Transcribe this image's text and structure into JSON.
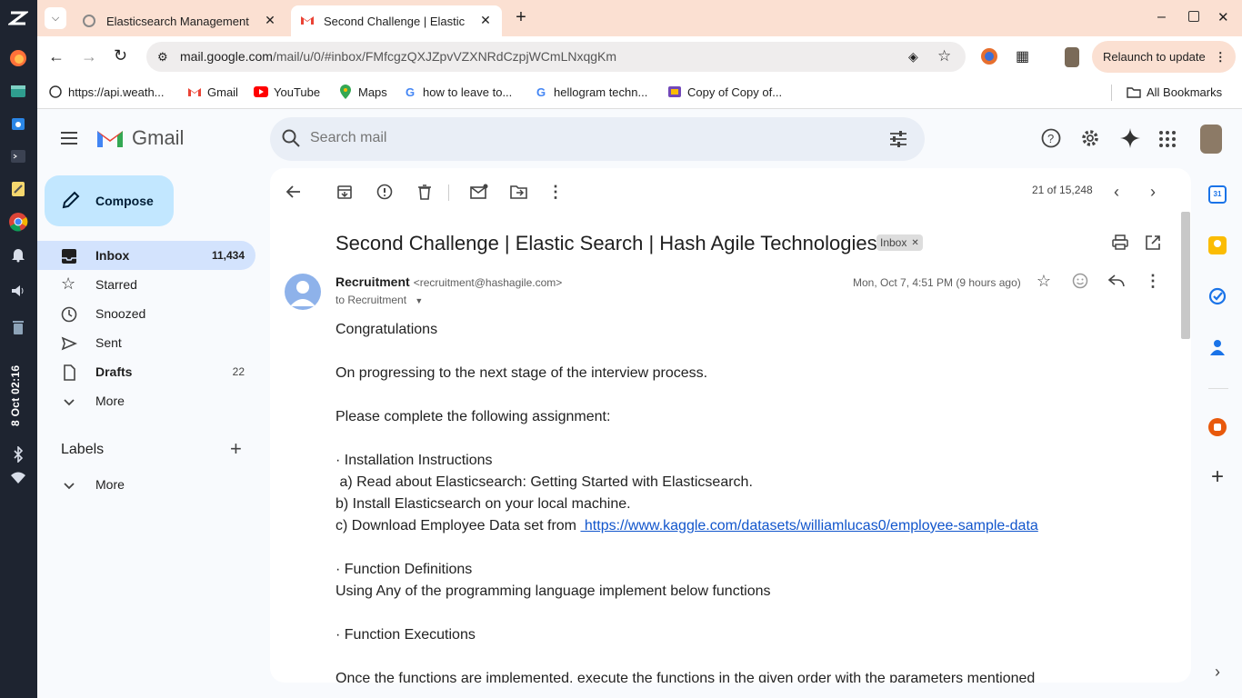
{
  "taskbar": {
    "clock": "8 Oct 02:16"
  },
  "browser": {
    "tabs": [
      {
        "title": "Elasticsearch Management"
      },
      {
        "title": "Second Challenge | Elastic"
      }
    ],
    "url_host": "mail.google.com",
    "url_path": "/mail/u/0/#inbox/FMfcgzQXJZpvVZXNRdCzpjWCmLNxqgKm",
    "relaunch": "Relaunch to update",
    "bookmarks": [
      "https://api.weath...",
      "Gmail",
      "YouTube",
      "Maps",
      "how to leave to...",
      "hellogram techn...",
      "Copy of Copy of..."
    ],
    "all_bookmarks": "All Bookmarks"
  },
  "gmail": {
    "brand": "Gmail",
    "search_placeholder": "Search mail",
    "compose": "Compose",
    "nav": [
      {
        "label": "Inbox",
        "count": "11,434"
      },
      {
        "label": "Starred",
        "count": ""
      },
      {
        "label": "Snoozed",
        "count": ""
      },
      {
        "label": "Sent",
        "count": ""
      },
      {
        "label": "Drafts",
        "count": "22"
      },
      {
        "label": "More",
        "count": ""
      }
    ],
    "labels_heading": "Labels",
    "labels_more": "More"
  },
  "message": {
    "position": "21 of 15,248",
    "subject": "Second Challenge | Elastic Search | Hash Agile Technologies",
    "chip": "Inbox",
    "sender_name": "Recruitment",
    "sender_email": "<recruitment@hashagile.com>",
    "to_line": "to Recruitment",
    "date": "Mon, Oct 7, 4:51 PM (9 hours ago)",
    "body": {
      "l1": "Congratulations",
      "l2": "On progressing to the next stage of the interview process.",
      "l3": "Please complete the following assignment:",
      "l4": "· Installation Instructions",
      "l5": " a) Read about Elasticsearch: Getting Started with Elasticsearch.",
      "l6": "b) Install Elasticsearch on your local machine.",
      "l7": "c) Download Employee Data set from ",
      "link": " https://www.kaggle.com/datasets/williamlucas0/employee-sample-data",
      "l8": "· Function Definitions",
      "l9": "Using Any of the programming language implement below functions",
      "l10": "· Function Executions",
      "l11": "Once the functions are implemented, execute the functions in the given order with the parameters mentioned"
    }
  },
  "colors": {
    "accent": "#0b57d0",
    "compose": "#c2e7ff",
    "inbox_selected": "#d3e3fd",
    "tabbar": "#fbe0d2",
    "link": "#1155cc"
  }
}
